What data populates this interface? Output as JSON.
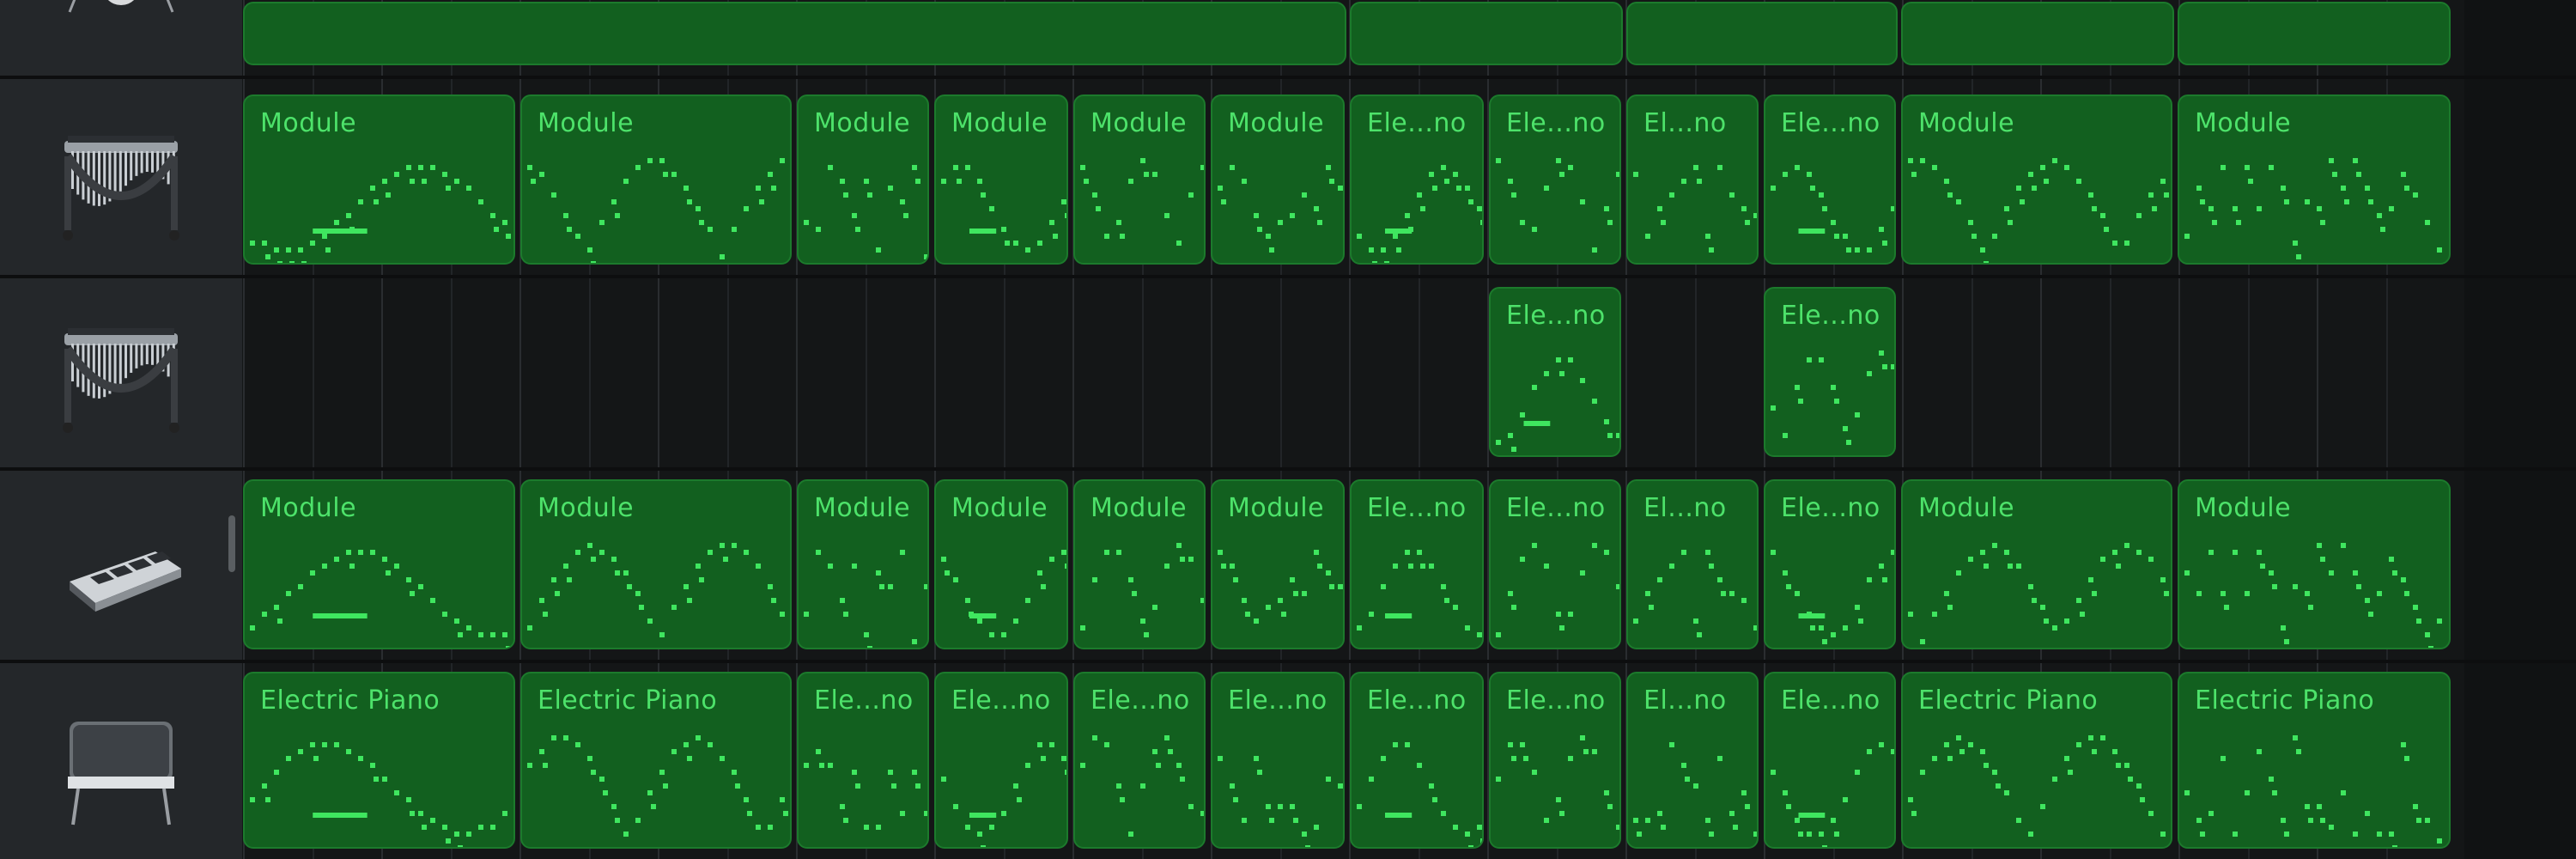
{
  "tracks": [
    {
      "id": "drums",
      "icon": "drum-kit-icon"
    },
    {
      "id": "vibes-1",
      "icon": "vibraphone-icon"
    },
    {
      "id": "vibes-2",
      "icon": "vibraphone-icon"
    },
    {
      "id": "synth-pad",
      "icon": "drum-machine-icon"
    },
    {
      "id": "electric-piano",
      "icon": "electric-piano-icon"
    }
  ],
  "regions": {
    "drums": [
      "",
      "",
      "",
      "",
      ""
    ],
    "vibes-1": [
      "Module",
      "Module",
      "Module",
      "Module",
      "Module",
      "Module",
      "Ele...no",
      "Ele...no",
      "El...no",
      "Ele...no",
      "Module",
      "Module"
    ],
    "vibes-2": [
      "Ele...no",
      "Ele...no"
    ],
    "synth-pad": [
      "Module",
      "Module",
      "Module",
      "Module",
      "Module",
      "Module",
      "Ele...no",
      "Ele...no",
      "El...no",
      "Ele...no",
      "Module",
      "Module"
    ],
    "electric-piano": [
      "Electric Piano",
      "Electric Piano",
      "Ele...no",
      "Ele...no",
      "Ele...no",
      "Ele...no",
      "Ele...no",
      "Ele...no",
      "El...no",
      "Ele...no",
      "Electric Piano",
      "Electric Piano"
    ]
  },
  "colors": {
    "region_fill": "#12601f",
    "region_border": "#1c7a2c",
    "note": "#3fe65f",
    "label": "#4de26a",
    "track_bg": "#151718",
    "header_bg": "#24272a"
  }
}
